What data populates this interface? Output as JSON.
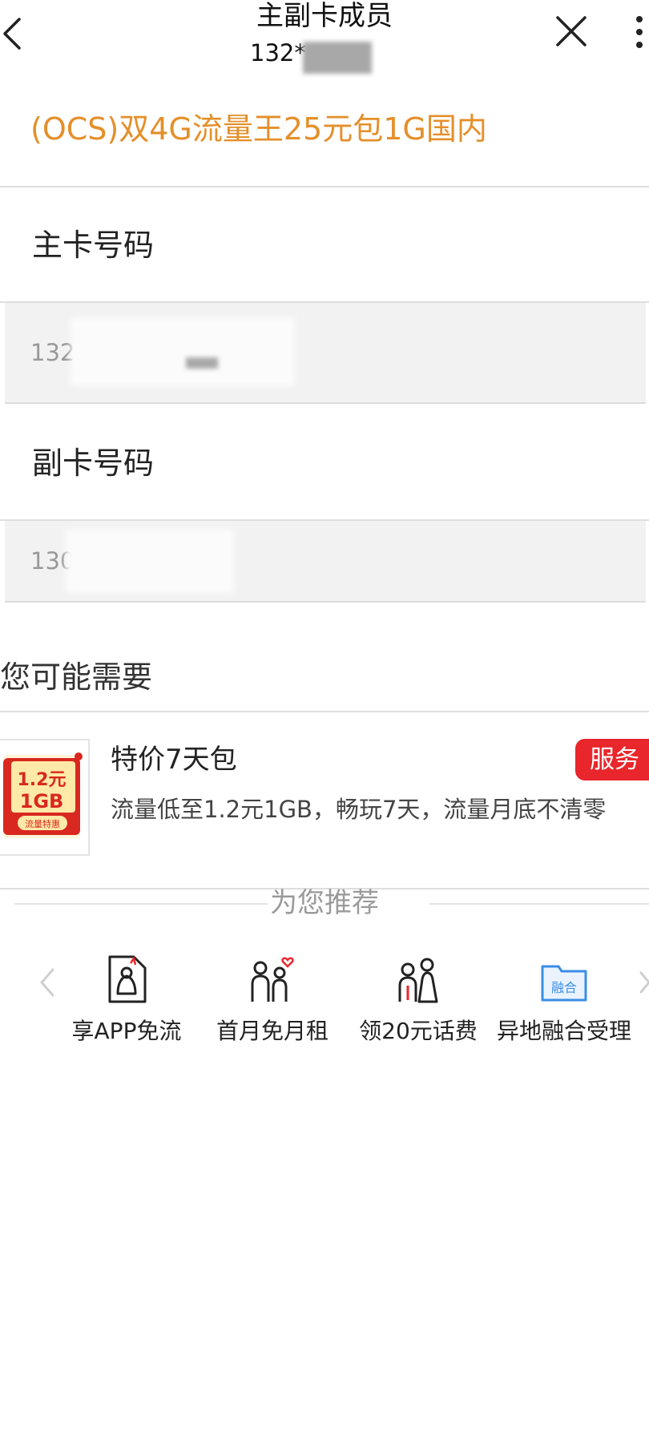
{
  "header": {
    "title": "主副卡成员",
    "subtitle": "132*"
  },
  "plan": {
    "name": "(OCS)双4G流量王25元包1G国内"
  },
  "primary": {
    "label": "主卡号码",
    "number": "132"
  },
  "secondary": {
    "label": "副卡号码",
    "number": "130"
  },
  "you_may_need": {
    "title": "您可能需要"
  },
  "product": {
    "title": "特价7天包",
    "description": "流量低至1.2元1GB，畅玩7天，流量月底不清零",
    "badge": "服务",
    "thumb_price": "1.2元",
    "thumb_amount": "1GB",
    "thumb_tag": "流量特惠"
  },
  "recommend": {
    "title": "为您推荐",
    "items": [
      {
        "label": "享APP免流",
        "icon": "app-free-traffic-icon"
      },
      {
        "label": "首月免月租",
        "icon": "couple-heart-icon"
      },
      {
        "label": "领20元话费",
        "icon": "couple-gift-icon"
      },
      {
        "label": "异地融合受理",
        "icon": "fusion-folder-icon",
        "icon_text": "融合"
      }
    ]
  },
  "colors": {
    "plan_orange": "#e48f2a",
    "badge_red": "#e8262c",
    "thumb_red": "#d8281f",
    "fusion_blue": "#3a8ee6"
  }
}
